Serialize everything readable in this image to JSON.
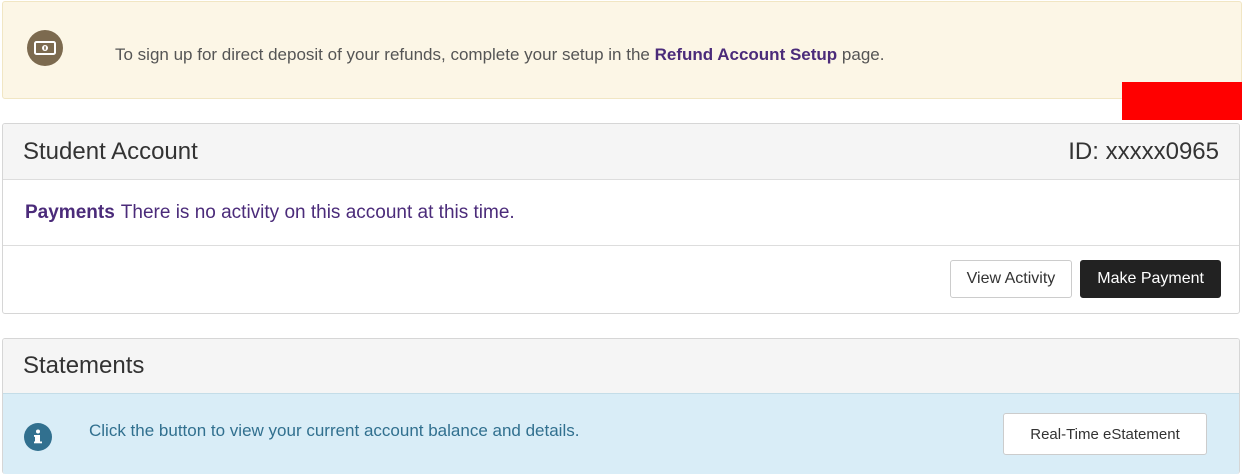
{
  "notice": {
    "text_before": "To sign up for direct deposit of your refunds, complete your setup in the",
    "link_text": "Refund Account Setup",
    "text_after": "page.",
    "icon": "money-bill-icon"
  },
  "account": {
    "title": "Student Account",
    "id_label": "ID: xxxxx0965",
    "section_label": "Payments",
    "status_text": "There is no activity on this account at this time.",
    "view_activity_label": "View Activity",
    "make_payment_label": "Make Payment"
  },
  "statements": {
    "title": "Statements",
    "info_text": "Click the button to view your current account balance and details.",
    "info_icon": "info-icon",
    "button_label": "Real-Time eStatement"
  },
  "colors": {
    "notice_bg": "#fcf6e6",
    "accent_purple": "#4b2b7a",
    "info_bg": "#d9edf7",
    "info_text": "#31708f",
    "redaction": "#ff0000"
  }
}
